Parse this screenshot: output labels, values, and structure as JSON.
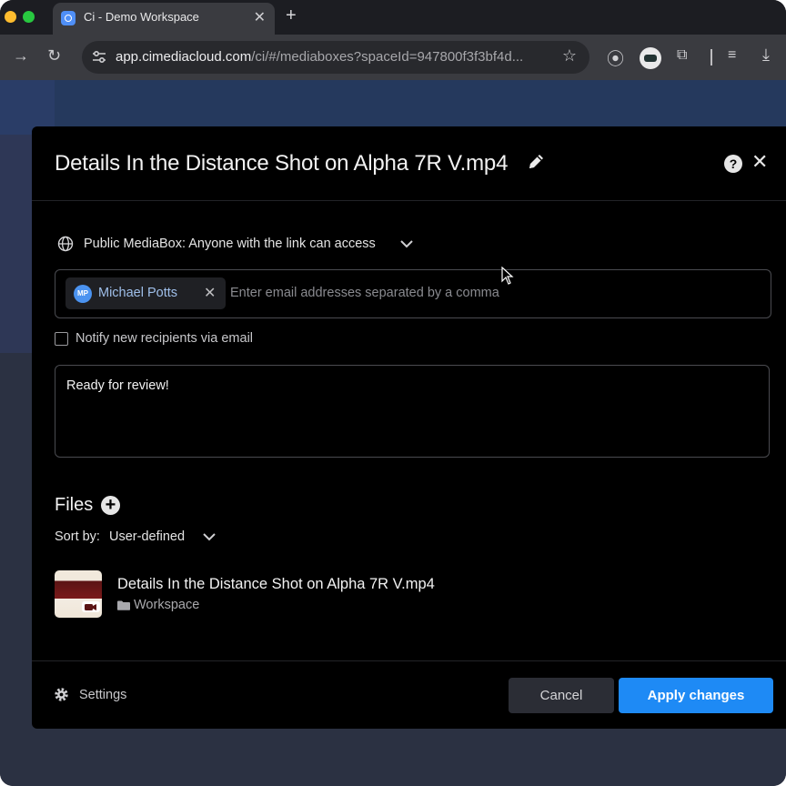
{
  "browser": {
    "tab_title": "Ci - Demo Workspace",
    "url_host": "app.cimediacloud.com",
    "url_path": "/ci/#/mediaboxes?spaceId=947800f3f3bf4d..."
  },
  "dialog": {
    "title": "Details In the Distance Shot on Alpha 7R V.mp4",
    "access_label": "Public MediaBox: Anyone with the link can access",
    "recipient": {
      "initials": "MP",
      "name": "Michael Potts"
    },
    "email_placeholder": "Enter email addresses separated by a comma",
    "notify_label": "Notify new recipients via email",
    "notify_checked": false,
    "message": "Ready for review!",
    "files_heading": "Files",
    "sort_label": "Sort by:",
    "sort_value": "User-defined",
    "files": [
      {
        "name": "Details In the Distance Shot on Alpha 7R V.mp4",
        "folder": "Workspace"
      }
    ],
    "settings_label": "Settings",
    "cancel_label": "Cancel",
    "apply_label": "Apply changes"
  },
  "colors": {
    "accent": "#1e8af5",
    "avatar": "#4b93f0",
    "modal_bg": "#000000"
  }
}
